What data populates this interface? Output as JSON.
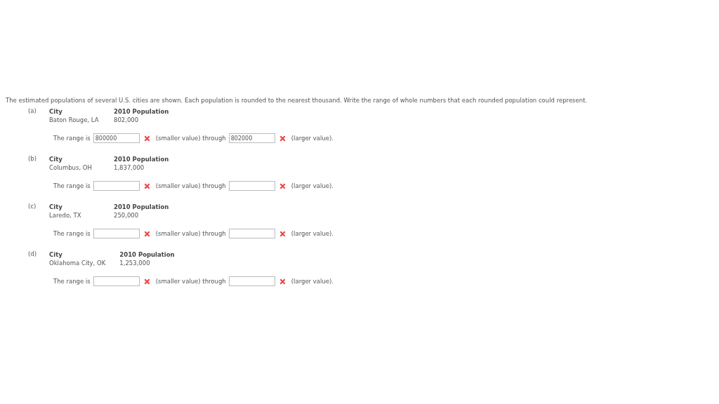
{
  "instructions": "The estimated populations of several U.S. cities are shown. Each population is rounded to the nearest thousand. Write the range of whole numbers that each rounded population could represent.",
  "parts": [
    {
      "label": "(a)",
      "city_header": "City",
      "population_header": "2010 Population",
      "city": "Baton Rouge, LA",
      "population": "802,000",
      "range_prefix": "The range is",
      "smaller": {
        "value": "800000",
        "correct": false
      },
      "middle_text": "(smaller value) through",
      "larger": {
        "value": "802000",
        "correct": false
      },
      "suffix": "(larger value)."
    },
    {
      "label": "(b)",
      "city_header": "City",
      "population_header": "2010 Population",
      "city": "Columbus, OH",
      "population": "1,837,000",
      "range_prefix": "The range is",
      "smaller": {
        "correct": false
      },
      "middle_text": "(smaller value) through",
      "larger": {
        "correct": false
      },
      "suffix": "(larger value)."
    },
    {
      "label": "(c)",
      "city_header": "City",
      "population_header": "2010 Population",
      "city": "Laredo, TX",
      "population": "250,000",
      "range_prefix": "The range is",
      "smaller": {
        "correct": false
      },
      "middle_text": "(smaller value) through",
      "larger": {
        "correct": false
      },
      "suffix": "(larger value)."
    },
    {
      "label": "(d)",
      "city_header": "City",
      "population_header": "2010 Population",
      "city": "Oklahoma City, OK",
      "population": "1,253,000",
      "range_prefix": "The range is",
      "smaller": {
        "correct": false
      },
      "middle_text": "(smaller value) through",
      "larger": {
        "correct": false
      },
      "suffix": "(larger value)."
    }
  ]
}
